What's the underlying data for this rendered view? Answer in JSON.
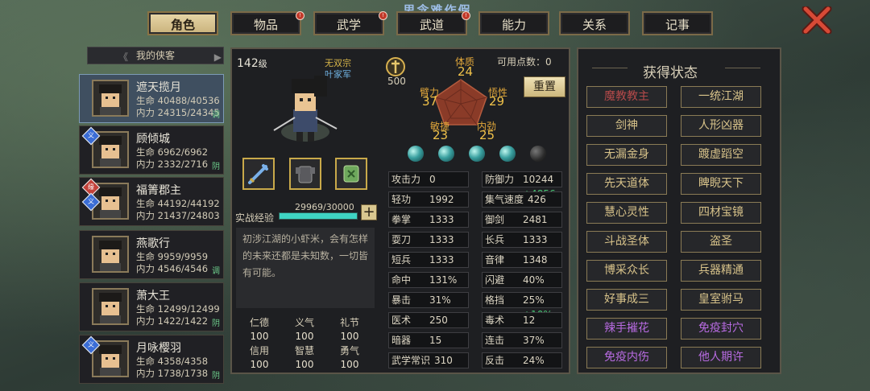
{
  "brand": "思念难作假",
  "tabs": [
    {
      "label": "角色"
    },
    {
      "label": "物品"
    },
    {
      "label": "武学"
    },
    {
      "label": "武道"
    },
    {
      "label": "能力"
    },
    {
      "label": "关系"
    },
    {
      "label": "记事"
    }
  ],
  "party": {
    "title": "我的侠客",
    "members": [
      {
        "name": "遮天揽月",
        "hp": "生命 40488/40536",
        "mp": "内力 24315/24345",
        "tag": "调"
      },
      {
        "name": "顾倾城",
        "hp": "生命 6962/6962",
        "mp": "内力 2332/2716",
        "tag": "阴",
        "badges": [
          "义"
        ]
      },
      {
        "name": "福箐郡主",
        "hp": "生命 44192/44192",
        "mp": "内力 21437/24803",
        "tag": "",
        "badges": [
          "缘",
          "义"
        ]
      },
      {
        "name": "燕歌行",
        "hp": "生命 9959/9959",
        "mp": "内力 4546/4546",
        "tag": "调"
      },
      {
        "name": "萧大王",
        "hp": "生命 12499/12499",
        "mp": "内力 1422/1422",
        "tag": "阴"
      },
      {
        "name": "月咏樱羽",
        "hp": "生命 4358/4358",
        "mp": "内力 1738/1738",
        "tag": "阴",
        "badges": [
          "义"
        ]
      }
    ]
  },
  "character": {
    "level": "142",
    "level_unit": "级",
    "sect": "无双宗",
    "faction": "叶家军",
    "fame_value": "500",
    "points_label": "可用点数：",
    "points_value": "0",
    "reset_label": "重置",
    "attrs": {
      "tizhi": {
        "label": "体质",
        "value": "24"
      },
      "bili": {
        "label": "臂力",
        "value": "37"
      },
      "wuxing": {
        "label": "悟性",
        "value": "29"
      },
      "minjie": {
        "label": "敏捷",
        "value": "23"
      },
      "neijin": {
        "label": "内劲",
        "value": "25"
      }
    },
    "exp_label": "实战经验",
    "exp_value": "29969/30000",
    "exp_ratio": 0.999,
    "description": "初涉江湖的小虾米，会有怎样的未来还都是未知数，一切皆有可能。",
    "virtues": [
      {
        "label": "仁德",
        "value": "100"
      },
      {
        "label": "义气",
        "value": "100"
      },
      {
        "label": "礼节",
        "value": "100"
      },
      {
        "label": "信用",
        "value": "100"
      },
      {
        "label": "智慧",
        "value": "100"
      },
      {
        "label": "勇气",
        "value": "100"
      }
    ],
    "orbs": [
      true,
      true,
      true,
      true,
      false
    ],
    "stats_left": [
      {
        "k": "攻击力",
        "v": "0"
      },
      {
        "k": "轻功",
        "v": "1992"
      },
      {
        "k": "拳掌",
        "v": "1333"
      },
      {
        "k": "耍刀",
        "v": "1333"
      },
      {
        "k": "短兵",
        "v": "1333"
      },
      {
        "k": "命中",
        "v": "131%"
      },
      {
        "k": "暴击",
        "v": "31%"
      },
      {
        "k": "医术",
        "v": "250"
      },
      {
        "k": "暗器",
        "v": "15"
      },
      {
        "k": "武学常识",
        "v": "310"
      }
    ],
    "stats_right": [
      {
        "k": "防御力",
        "v": "10244",
        "b": "+4856"
      },
      {
        "k": "集气速度",
        "v": "426"
      },
      {
        "k": "御剑",
        "v": "2481"
      },
      {
        "k": "长兵",
        "v": "1333"
      },
      {
        "k": "音律",
        "v": "1348"
      },
      {
        "k": "闪避",
        "v": "40%"
      },
      {
        "k": "格挡",
        "v": "25%",
        "b": "+10%"
      },
      {
        "k": "毒术",
        "v": "12"
      },
      {
        "k": "连击",
        "v": "37%"
      },
      {
        "k": "反击",
        "v": "24%"
      }
    ]
  },
  "status": {
    "title": "获得状态",
    "items": [
      {
        "label": "魔教教主",
        "color": "red"
      },
      {
        "label": "一统江湖"
      },
      {
        "label": "剑神"
      },
      {
        "label": "人形凶器"
      },
      {
        "label": "无漏金身"
      },
      {
        "label": "踱虚蹈空"
      },
      {
        "label": "先天道体"
      },
      {
        "label": "睥睨天下"
      },
      {
        "label": "慧心灵性"
      },
      {
        "label": "四材宝镜"
      },
      {
        "label": "斗战圣体"
      },
      {
        "label": "盗圣"
      },
      {
        "label": "博采众长"
      },
      {
        "label": "兵器精通"
      },
      {
        "label": "好事成三"
      },
      {
        "label": "皇室驸马"
      },
      {
        "label": "辣手摧花",
        "color": "purple"
      },
      {
        "label": "免疫封穴",
        "color": "purple"
      },
      {
        "label": "免疫内伤",
        "color": "purple"
      },
      {
        "label": "他人期许",
        "color": "purple"
      }
    ]
  }
}
